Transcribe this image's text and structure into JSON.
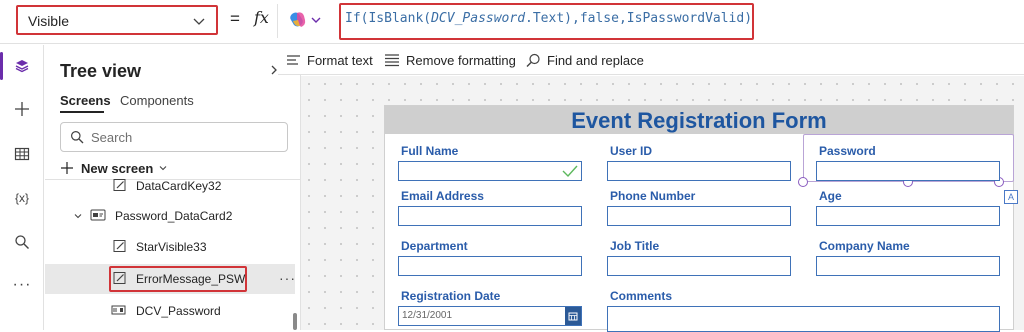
{
  "formula_bar": {
    "property": "Visible",
    "equals": "=",
    "fx": "fx",
    "formula": {
      "fn1": "If(",
      "fn2": "IsBlank(",
      "var": "DCV_Password",
      "rest": ".Text),",
      "kw": "false",
      "sep": ",",
      "tail": "IsPasswordValid)"
    }
  },
  "rail": {
    "items": [
      "layers-icon",
      "plus-icon",
      "table-icon",
      "variables-icon",
      "search-icon",
      "more-icon"
    ],
    "variables_label": "{x}",
    "more_label": "···"
  },
  "tree": {
    "title": "Tree view",
    "tabs": [
      "Screens",
      "Components"
    ],
    "search_placeholder": "Search",
    "new_screen": "New screen",
    "items": [
      {
        "label": "DataCardKey32",
        "icon": "label-edit-icon"
      },
      {
        "label": "Password_DataCard2",
        "icon": "card-icon"
      },
      {
        "label": "StarVisible33",
        "icon": "label-edit-icon"
      },
      {
        "label": "ErrorMessage_PSW",
        "icon": "label-edit-icon"
      },
      {
        "label": "DCV_Password",
        "icon": "textinput-icon"
      }
    ],
    "more": "···"
  },
  "toolbar": {
    "format_text": "Format text",
    "remove_formatting": "Remove formatting",
    "find_replace": "Find and replace"
  },
  "form": {
    "title": "Event Registration Form",
    "labels": {
      "full_name": "Full Name",
      "user_id": "User ID",
      "password": "Password",
      "email": "Email Address",
      "phone": "Phone Number",
      "age": "Age",
      "department": "Department",
      "job_title": "Job Title",
      "company": "Company Name",
      "reg_date": "Registration Date",
      "comments": "Comments"
    },
    "date_value": "12/31/2001",
    "a_badge": "A"
  },
  "colors": {
    "highlight": "#d13438",
    "form_title": "#1e56a0",
    "label": "#2a5caa",
    "accent": "#6b2dab"
  }
}
